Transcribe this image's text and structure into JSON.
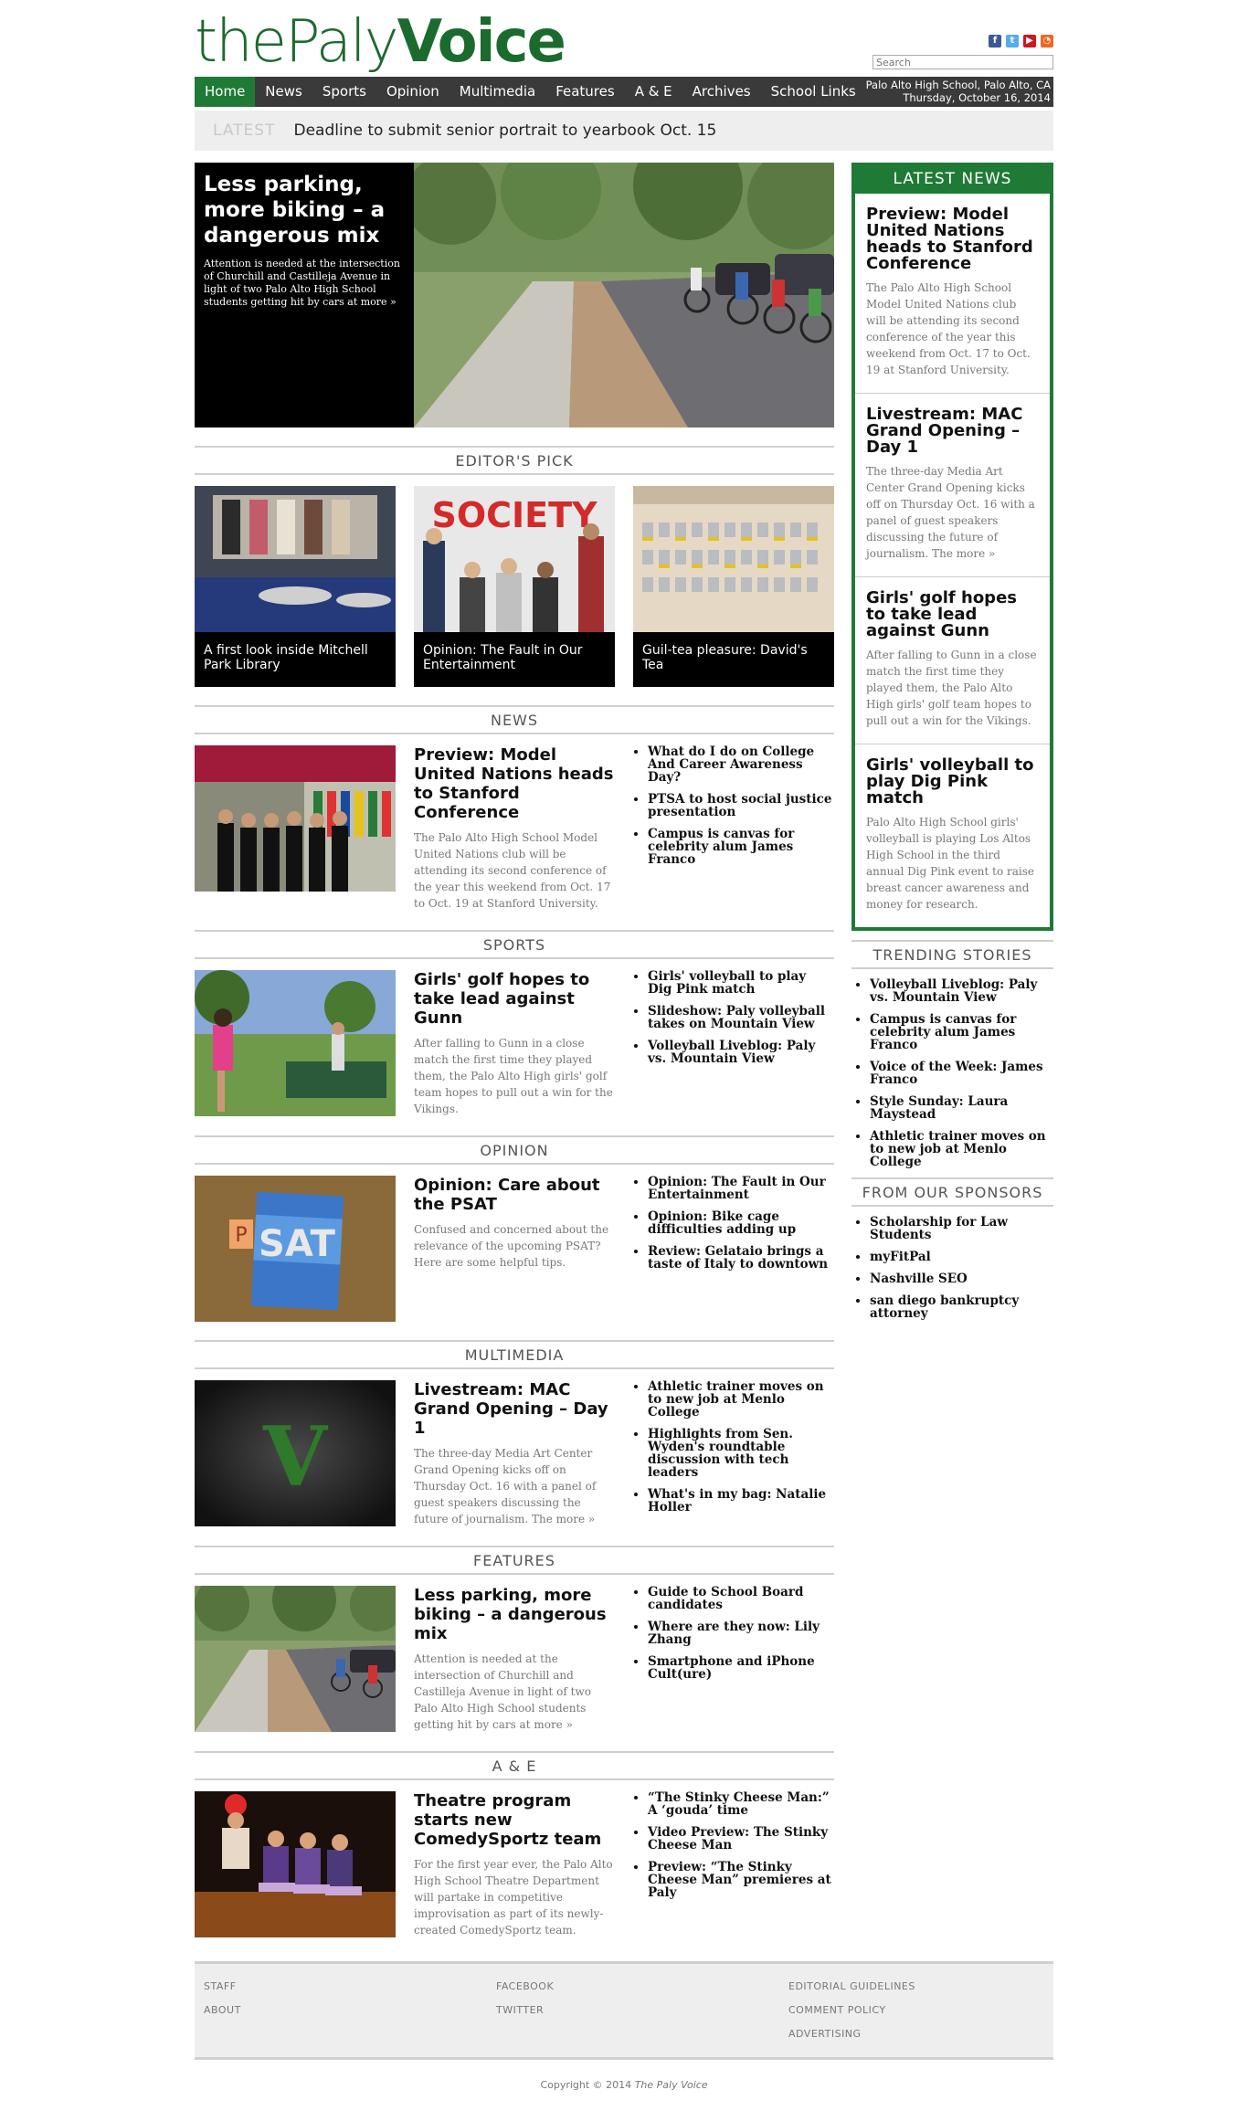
{
  "site": {
    "logo_thin": "thePaly",
    "logo_bold": "Voice",
    "search_placeholder": "Search",
    "location": "Palo Alto High School, Palo Alto, CA",
    "date": "Thursday, October 16, 2014",
    "social_icons": [
      "facebook-icon",
      "twitter-icon",
      "youtube-icon",
      "rss-icon"
    ]
  },
  "nav": {
    "items": [
      "Home",
      "News",
      "Sports",
      "Opinion",
      "Multimedia",
      "Features",
      "A & E",
      "Archives",
      "School Links"
    ],
    "active": "Home"
  },
  "ticker": {
    "label": "LATEST",
    "text": "Deadline to submit senior portrait to yearbook Oct. 15"
  },
  "hero": {
    "title": "Less parking, more biking – a dangerous mix",
    "summary": "Attention is needed at the intersection of Churchill and Castilleja Avenue in light of two Palo Alto High School students getting hit by cars at more »"
  },
  "editors_pick": {
    "heading": "EDITOR'S PICK",
    "items": [
      "A first look inside Mitchell Park Library",
      "Opinion: The Fault in Our Entertainment",
      "Guil-tea pleasure: David's Tea"
    ]
  },
  "sections": [
    {
      "heading": "NEWS",
      "title": "Preview: Model United Nations heads to Stanford Conference",
      "summary": "The Palo Alto High School Model United Nations club will be attending its second conference of the year this weekend from Oct. 17 to Oct. 19 at Stanford University.",
      "links": [
        "What do I do on College And Career Awareness Day?",
        "PTSA to host social justice presentation",
        "Campus is canvas for celebrity alum James Franco"
      ]
    },
    {
      "heading": "SPORTS",
      "title": "Girls' golf hopes to take lead against Gunn",
      "summary": "After falling to Gunn in a close match the first time they played them, the Palo Alto High girls' golf team hopes to pull out a win for the Vikings.",
      "links": [
        "Girls' volleyball to play Dig Pink match",
        "Slideshow: Paly volleyball takes on Mountain View",
        "Volleyball Liveblog: Paly vs. Mountain View"
      ]
    },
    {
      "heading": "OPINION",
      "title": "Opinion: Care about the PSAT",
      "summary": "Confused and concerned about the relevance of the upcoming PSAT? Here are some helpful tips.",
      "links": [
        "Opinion: The Fault in Our Entertainment",
        "Opinion: Bike cage difficulties adding up",
        "Review: Gelataio brings a taste of Italy to downtown"
      ]
    },
    {
      "heading": "MULTIMEDIA",
      "title": "Livestream: MAC Grand Opening – Day 1",
      "summary": "The three-day Media Art Center Grand Opening kicks off on Thursday Oct. 16 with a panel of guest speakers discussing the future of journalism. The more »",
      "links": [
        "Athletic trainer moves on to new job at Menlo College",
        "Highlights from Sen. Wyden's roundtable discussion with tech leaders",
        "What's in my bag: Natalie Holler"
      ]
    },
    {
      "heading": "FEATURES",
      "title": "Less parking, more biking – a dangerous mix",
      "summary": "Attention is needed at the intersection of Churchill and Castilleja Avenue in light of two Palo Alto High School students getting hit by cars at more »",
      "links": [
        "Guide to School Board candidates",
        "Where are they now: Lily Zhang",
        "Smartphone and iPhone Cult(ure)"
      ]
    },
    {
      "heading": "A & E",
      "title": "Theatre program starts new ComedySportz team",
      "summary": "For the first year ever, the Palo Alto High School Theatre Department will partake in competitive improvisation as part of its newly-created ComedySportz team.",
      "links": [
        "“The Stinky Cheese Man:” A ‘gouda’ time",
        "Video Preview: The Stinky Cheese Man",
        "Preview: “The Stinky Cheese Man” premieres at Paly"
      ]
    }
  ],
  "latest_news": {
    "heading": "LATEST NEWS",
    "items": [
      {
        "title": "Preview: Model United Nations heads to Stanford Conference",
        "summary": "The Palo Alto High School Model United Nations club will be attending its second conference of the year this weekend from Oct. 17 to Oct. 19 at Stanford University."
      },
      {
        "title": "Livestream: MAC Grand Opening – Day 1",
        "summary": "The three-day Media Art Center Grand Opening kicks off on Thursday Oct. 16 with a panel of guest speakers discussing the future of journalism. The more »"
      },
      {
        "title": "Girls' golf hopes to take lead against Gunn",
        "summary": "After falling to Gunn in a close match the first time they played them, the Palo Alto High girls' golf team hopes to pull out a win for the Vikings."
      },
      {
        "title": "Girls' volleyball to play Dig Pink match",
        "summary": "Palo Alto High School girls' volleyball is playing Los Altos High School in the third annual Dig Pink event to raise breast cancer awareness and money for research."
      }
    ]
  },
  "trending": {
    "heading": "TRENDING STORIES",
    "items": [
      "Volleyball Liveblog: Paly vs. Mountain View",
      "Campus is canvas for celebrity alum James Franco",
      "Voice of the Week: James Franco",
      "Style Sunday: Laura Maystead",
      "Athletic trainer moves on to new job at Menlo College"
    ]
  },
  "sponsors": {
    "heading": "FROM OUR SPONSORS",
    "items": [
      "Scholarship for Law Students",
      "myFitPal",
      "Nashville SEO",
      "san diego bankruptcy attorney"
    ]
  },
  "footer": {
    "col1": [
      "STAFF",
      "ABOUT"
    ],
    "col2": [
      "FACEBOOK",
      "TWITTER"
    ],
    "col3": [
      "EDITORIAL GUIDELINES",
      "COMMENT POLICY",
      "ADVERTISING"
    ],
    "copyright_prefix": "Copyright © 2014",
    "copyright_name": "The Paly Voice"
  },
  "colors": {
    "brand_green": "#1f7a36",
    "nav_bg": "#3a3a3a",
    "ticker_bg": "#eeeeee"
  }
}
